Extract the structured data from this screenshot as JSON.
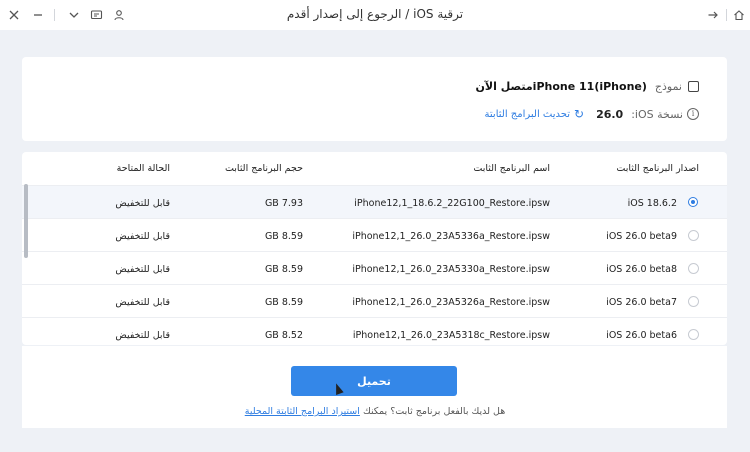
{
  "window": {
    "title": "ترقية iOS / الرجوع إلى إصدار أقدم"
  },
  "device": {
    "model_label": "نموذج",
    "model_name": "iPhone 11(iPhone)",
    "status": "متصل الآن",
    "version_label": "نسخة iOS:",
    "version_value": "26.0",
    "refresh_label": "تحديث البرامج الثابتة"
  },
  "table": {
    "headers": {
      "version": "اصدار البرنامج الثابت",
      "name": "اسم البرنامج الثابت",
      "size": "حجم البرنامج الثابت",
      "status": "الحالة المتاحة"
    },
    "rows": [
      {
        "version": "iOS 18.6.2",
        "name": "iPhone12,1_18.6.2_22G100_Restore.ipsw",
        "size": "GB 7.93",
        "status": "قابل للتخفيض",
        "selected": true
      },
      {
        "version": "iOS 26.0 beta9",
        "name": "iPhone12,1_26.0_23A5336a_Restore.ipsw",
        "size": "GB 8.59",
        "status": "قابل للتخفيض",
        "selected": false
      },
      {
        "version": "iOS 26.0 beta8",
        "name": "iPhone12,1_26.0_23A5330a_Restore.ipsw",
        "size": "GB 8.59",
        "status": "قابل للتخفيض",
        "selected": false
      },
      {
        "version": "iOS 26.0 beta7",
        "name": "iPhone12,1_26.0_23A5326a_Restore.ipsw",
        "size": "GB 8.59",
        "status": "قابل للتخفيض",
        "selected": false
      },
      {
        "version": "iOS 26.0 beta6",
        "name": "iPhone12,1_26.0_23A5318c_Restore.ipsw",
        "size": "GB 8.52",
        "status": "قابل للتخفيض",
        "selected": false
      }
    ]
  },
  "actions": {
    "download_label": "تحميل",
    "note_prefix": "هل لديك بالفعل برنامج ثابت؟ يمكنك",
    "note_link": "استيراد البرامج الثابتة المحلية"
  },
  "colors": {
    "accent": "#3487e8",
    "link": "#2f7de1"
  }
}
